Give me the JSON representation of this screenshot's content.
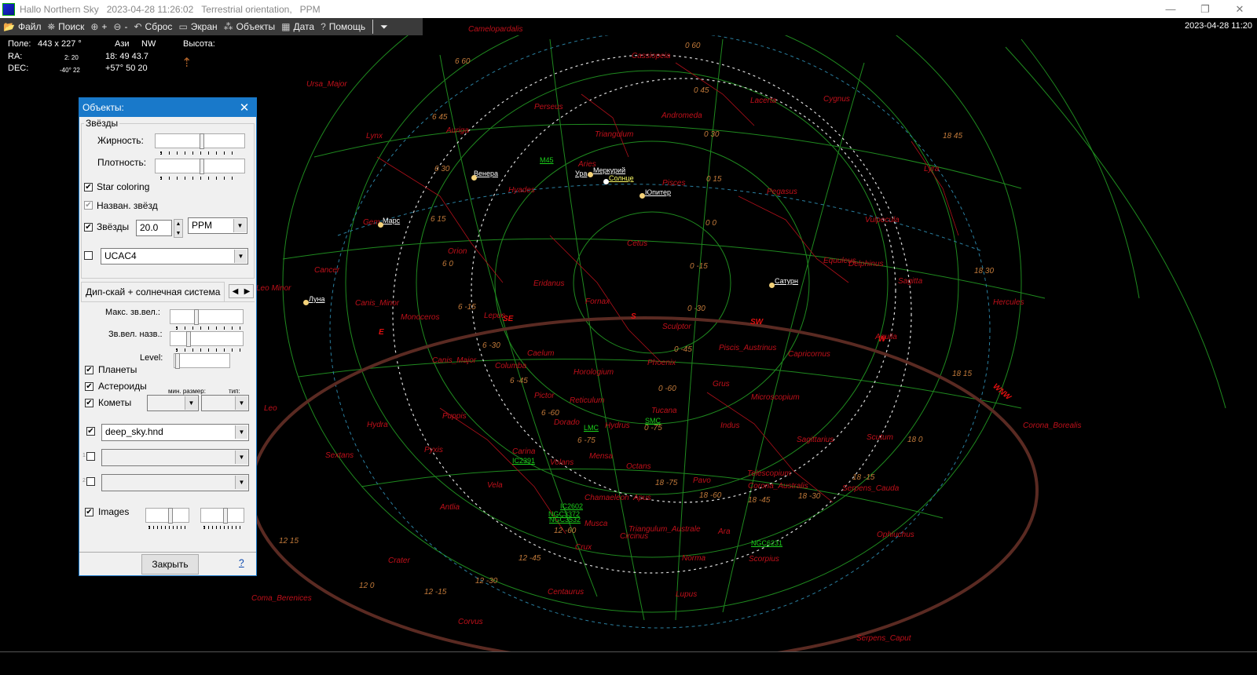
{
  "titlebar": {
    "app": "Hallo Northern Sky",
    "datetime": "2023-04-28  11:26:02",
    "orientation": "Terrestrial orientation,",
    "catalog": "PPM",
    "minimize": "—",
    "maximize": "❐",
    "close": "✕"
  },
  "toolbar": {
    "file": "Файл",
    "search": "Поиск",
    "zoom_in": "+",
    "zoom_out": "-",
    "reset": "Сброс",
    "screen": "Экран",
    "objects": "Объекты",
    "date": "Дата",
    "help": "Помощь",
    "more": "⏷"
  },
  "clock": "2023-04-28  11:20",
  "info": {
    "field_label": "Поле:",
    "field_value": "443  x   227 °",
    "azi_label": "Ази",
    "azi_value": "NW",
    "alt_label": "Высота:",
    "ra_label": "RA:",
    "ra_small": "2: 20",
    "ra_value": "18: 49 43.7",
    "dec_label": "DEC:",
    "dec_small": "-40° 22",
    "dec_value": "+57° 50 20"
  },
  "sky": {
    "constellations": [
      "Camelopardalis",
      "Cassiopeia",
      "Ursa_Major",
      "Lacerta",
      "Cygnus",
      "Perseus",
      "Andromeda",
      "Lynx",
      "Auriga",
      "Triangulum",
      "Aries",
      "Pisces",
      "Pegasus",
      "Lyra",
      "Gem",
      "Orion",
      "Cetus",
      "Vulpecula",
      "Equuleus",
      "Delphinus",
      "Cancer",
      "Sagitta",
      "Eridanus",
      "Canis_Minor",
      "Fornax",
      "Monoceros",
      "Lepus",
      "Hercules",
      "Sculptor",
      "Aquila",
      "Piscis_Austrinus",
      "Canis_Major",
      "Caelum",
      "Columba",
      "Phoenix",
      "Capricornus",
      "Horologium",
      "Grus",
      "Pictor",
      "Reticulum",
      "Microscopium",
      "Leo",
      "Puppis",
      "Tucana",
      "Hydra",
      "Dorado",
      "Hydrus",
      "Indus",
      "Corona_Borealis",
      "Sagittarius",
      "Scutum",
      "Pyxis",
      "Carina",
      "Mensa",
      "Sextans",
      "Volans",
      "Octans",
      "Vela",
      "Pavo",
      "Telescopium",
      "Corona_Australis",
      "Serpens_Cauda",
      "Antlia",
      "Chamaeleon",
      "Apus",
      "Musca",
      "Triangulum_Australe",
      "Ara",
      "Ophiuchus",
      "Circinus",
      "Crux",
      "Crater",
      "Norma",
      "Scorpius",
      "Centaurus",
      "Lupus",
      "Coma_Berenices",
      "Corvus",
      "Serpens_Caput",
      "Hyades",
      "Leo Minor"
    ],
    "planets": [
      "Венера",
      "Меркурий",
      "Ура",
      "Солнце",
      "Юпитер",
      "Марс",
      "Сатурн",
      "Луна"
    ],
    "deep_sky": [
      "M45",
      "LMC",
      "SMC",
      "IC2391",
      "IC2602",
      "NGC3372",
      "NGC3532",
      "NGC6231"
    ],
    "compass": [
      "SE",
      "S",
      "SW",
      "W",
      "E",
      "WNW"
    ],
    "grid": [
      "6 60",
      "0 60",
      "0 45",
      "6 45",
      "0 30",
      "6 30",
      "0 15",
      "6 15",
      "0 0",
      "6 0",
      "0 -15",
      "6 -15",
      "0 -30",
      "6 -30",
      "0 -45",
      "6 -45",
      "0 -60",
      "6 -60",
      "6 -75",
      "0 -75",
      "18 -75",
      "18 -60",
      "18 -45",
      "18 -30",
      "18 -15",
      "18 0",
      "18 15",
      "18 30",
      "18 45",
      "12 15",
      "12 0",
      "12 -15",
      "12 -30",
      "12 -45",
      "12 -60"
    ],
    "colors": {
      "constellation": "#c0101a",
      "grid": "#1f8a1f",
      "horizon": "#5a2a22",
      "planet": "#f4d27a",
      "sun": "#ffff66",
      "deep_sky": "#1bd11b"
    }
  },
  "dialog": {
    "title": "Объекты:",
    "close": "✕",
    "stars_group": "Звёзды",
    "boldness": "Жирность:",
    "density": "Плотность:",
    "star_coloring": "Star coloring",
    "star_coloring_checked": true,
    "star_names": "Назван. звёзд",
    "stars": "Звёзды",
    "stars_mag": "20.0",
    "stars_catalog": "PPM",
    "ucac_catalog": "UCAC4",
    "tab": "Дип-скай + солнечная система",
    "max_mag": "Макс. зв.вел.:",
    "name_mag": "Зв.вел. назв.:",
    "level": "Level:",
    "planets": "Планеты",
    "asteroids": "Астероиды",
    "comets": "Кометы",
    "min_size": "мин. размер:",
    "type": "тип:",
    "deep_sky_file": "deep_sky.hnd",
    "slot1": "1",
    "slot2": "2",
    "images": "Images",
    "close_button": "Закрыть",
    "help": "?"
  }
}
